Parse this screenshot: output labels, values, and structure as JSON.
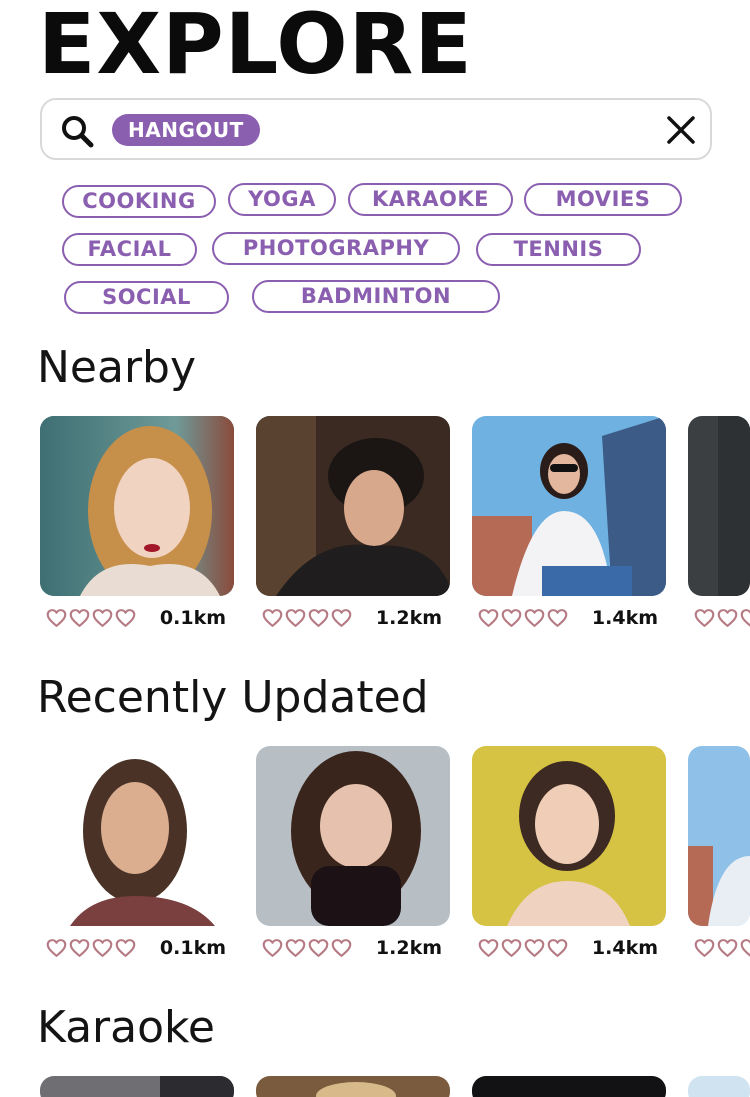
{
  "header": {
    "title": "EXPLORE"
  },
  "search": {
    "chip": "HANGOUT"
  },
  "tags": [
    "COOKING",
    "YOGA",
    "KARAOKE",
    "MOVIES",
    "FACIAL",
    "PHOTOGRAPHY",
    "TENNIS",
    "SOCIAL",
    "BADMINTON"
  ],
  "sections": {
    "nearby": {
      "title": "Nearby",
      "cards": [
        {
          "distance": "0.1km",
          "rating": 0
        },
        {
          "distance": "1.2km",
          "rating": 0
        },
        {
          "distance": "1.4km",
          "rating": 0
        }
      ]
    },
    "recent": {
      "title": "Recently Updated",
      "cards": [
        {
          "distance": "0.1km",
          "rating": 0
        },
        {
          "distance": "1.2km",
          "rating": 0
        },
        {
          "distance": "1.4km",
          "rating": 0
        }
      ]
    },
    "karaoke": {
      "title": "Karaoke"
    }
  },
  "colors": {
    "accent": "#8b5fb0",
    "heart": "#b57a84"
  },
  "icons": {
    "search": "search-icon",
    "clear": "close-icon",
    "rating": "heart-outline-icon"
  }
}
